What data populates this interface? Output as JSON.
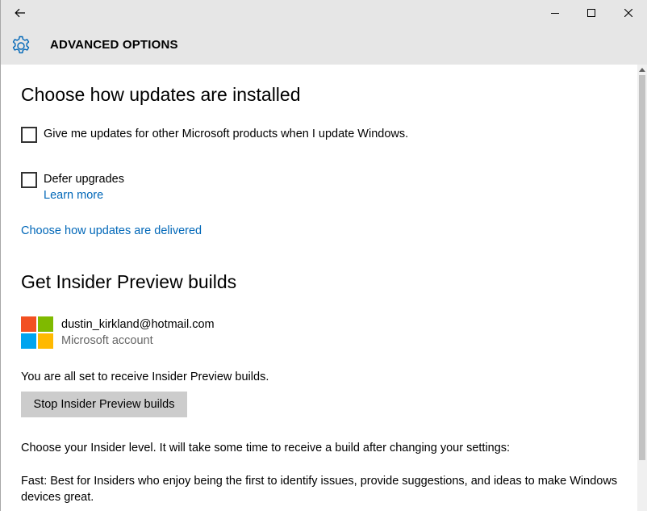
{
  "window": {
    "back_icon": "back-arrow-icon",
    "minimize_icon": "minimize-icon",
    "maximize_icon": "maximize-icon",
    "close_icon": "close-icon"
  },
  "header": {
    "icon": "gear-icon",
    "title": "ADVANCED OPTIONS",
    "accent_color": "#0067b8"
  },
  "updates": {
    "heading": "Choose how updates are installed",
    "checkbox_ms_products": {
      "label": "Give me updates for other Microsoft products when I update Windows.",
      "checked": false
    },
    "checkbox_defer": {
      "label": "Defer upgrades",
      "checked": false
    },
    "learn_more": "Learn more",
    "delivered_link": "Choose how updates are delivered"
  },
  "insider": {
    "heading": "Get Insider Preview builds",
    "account_email": "dustin_kirkland@hotmail.com",
    "account_type": "Microsoft account",
    "status": "You are all set to receive Insider Preview builds.",
    "stop_button": "Stop Insider Preview builds",
    "level_intro": "Choose your Insider level. It will take some time to receive a build after changing your settings:",
    "fast_desc": " Fast: Best for Insiders who enjoy being the first to identify issues, provide suggestions, and ideas to make Windows devices great."
  },
  "colors": {
    "link": "#0067b8",
    "logo_red": "#f25022",
    "logo_green": "#7fba00",
    "logo_blue": "#00a4ef",
    "logo_yellow": "#ffb900"
  }
}
